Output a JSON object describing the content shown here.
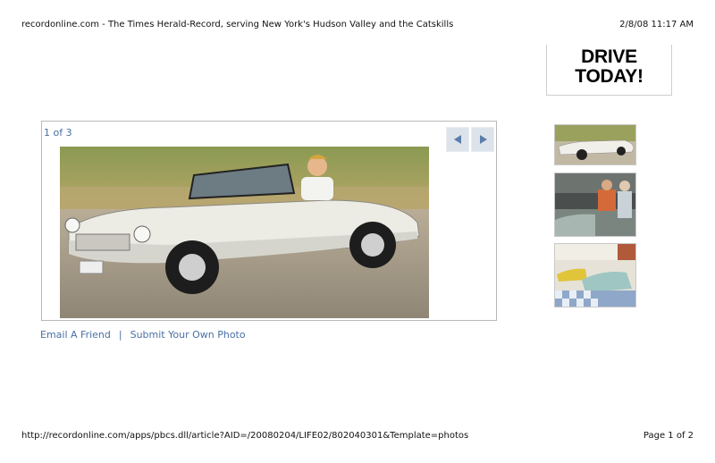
{
  "print_header": {
    "title": "recordonline.com - The Times Herald-Record, serving New York's Hudson Valley and the Catskills",
    "datetime": "2/8/08 11:17 AM"
  },
  "ad": {
    "text": "DRIVE\nTODAY!"
  },
  "gallery": {
    "counter": "1 of 3",
    "prev_icon": "triangle-left",
    "next_icon": "triangle-right"
  },
  "links": {
    "email_friend": "Email A Friend",
    "separator": "|",
    "submit_photo": "Submit Your Own Photo"
  },
  "thumbnails": [
    {
      "subject": "white convertible car"
    },
    {
      "subject": "two people in garage"
    },
    {
      "subject": "classic cars in showroom"
    }
  ],
  "print_footer": {
    "url": "http://recordonline.com/apps/pbcs.dll/article?AID=/20080204/LIFE02/802040301&Template=photos",
    "page": "Page 1 of 2"
  },
  "colors": {
    "link": "#4a70a4",
    "nav_button": "#dde3ea",
    "frame_border": "#b9b9b9"
  }
}
